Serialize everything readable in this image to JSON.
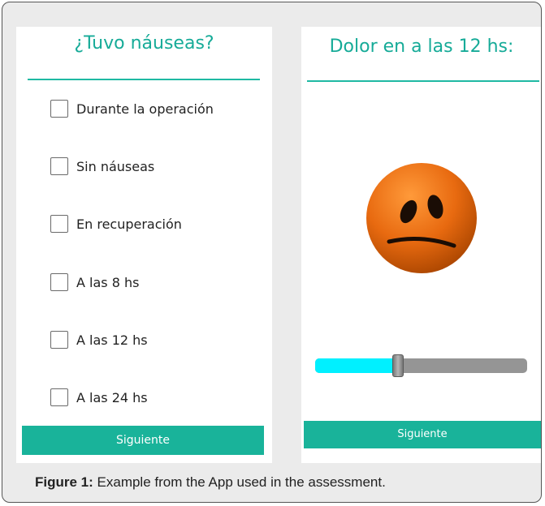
{
  "left_panel": {
    "title": "¿Tuvo náuseas?",
    "options": [
      {
        "label": "Durante la operación",
        "checked": false
      },
      {
        "label": "Sin náuseas",
        "checked": false
      },
      {
        "label": "En recuperación",
        "checked": false
      },
      {
        "label": "A las 8 hs",
        "checked": false
      },
      {
        "label": "A las 12 hs",
        "checked": false
      },
      {
        "label": "A las 24 hs",
        "checked": false
      }
    ],
    "button_label": "Siguiente"
  },
  "right_panel": {
    "title": "Dolor en a las 12 hs:",
    "face_icon": "uneasy-face-emoji",
    "slider_value_fraction": 0.39,
    "button_label": "Siguiente"
  },
  "caption": {
    "label": "Figure 1:",
    "text": " Example from the App used in the assessment."
  },
  "colors": {
    "accent": "#16ab98",
    "button": "#19b39a",
    "slider_fill": "#00f0ff",
    "slider_track": "#959595",
    "face": "#e86a10"
  }
}
